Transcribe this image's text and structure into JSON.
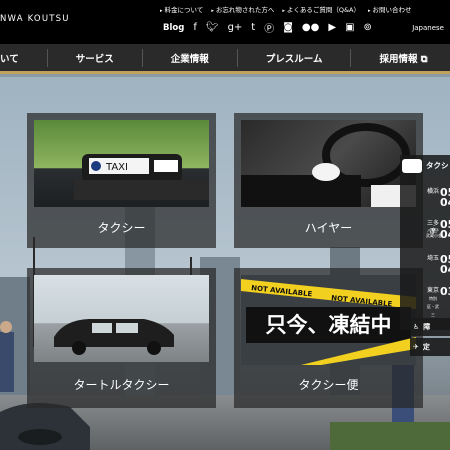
{
  "header": {
    "logo": "NWA KOUTSU",
    "top_links": [
      "料金について",
      "お忘れ物された方へ",
      "よくあるご質問（Q&A）",
      "お問い合わせ"
    ],
    "blog_label": "Blog",
    "social_icons": [
      "facebook-icon",
      "twitter-icon",
      "googleplus-icon",
      "tumblr-icon",
      "pinterest-icon",
      "instagram-icon",
      "flickr-icon",
      "youtube-icon",
      "niconico-icon",
      "tripadvisor-icon"
    ],
    "language": "Japanese"
  },
  "nav": {
    "items": [
      "いて",
      "サービス",
      "企業情報",
      "プレスルーム",
      "採用情報 ⧉"
    ]
  },
  "cards": [
    {
      "label": "タクシー",
      "image_text": "TAXI"
    },
    {
      "label": "ハイヤー"
    },
    {
      "label": "タートルタクシー"
    },
    {
      "label": "タクシー便",
      "image_text": "只今、凍結中",
      "tape_text": "NOT AVAILABLE"
    }
  ],
  "side_panel": {
    "title": "タクシ",
    "rows": [
      {
        "place": "横浜",
        "value": "05\n04"
      },
      {
        "place": "三多摩",
        "sub": "八王子\n武蔵小金",
        "value": "05\n04"
      },
      {
        "place": "埼玉",
        "value": "05\n04"
      },
      {
        "place": "東京",
        "sub": "特別区・武三",
        "value": "03"
      }
    ],
    "buttons": [
      "障",
      "定"
    ]
  },
  "colors": {
    "accent_gold": "#bfa15a",
    "nav_bg": "#2a2a2a",
    "top_bg": "#000000"
  }
}
